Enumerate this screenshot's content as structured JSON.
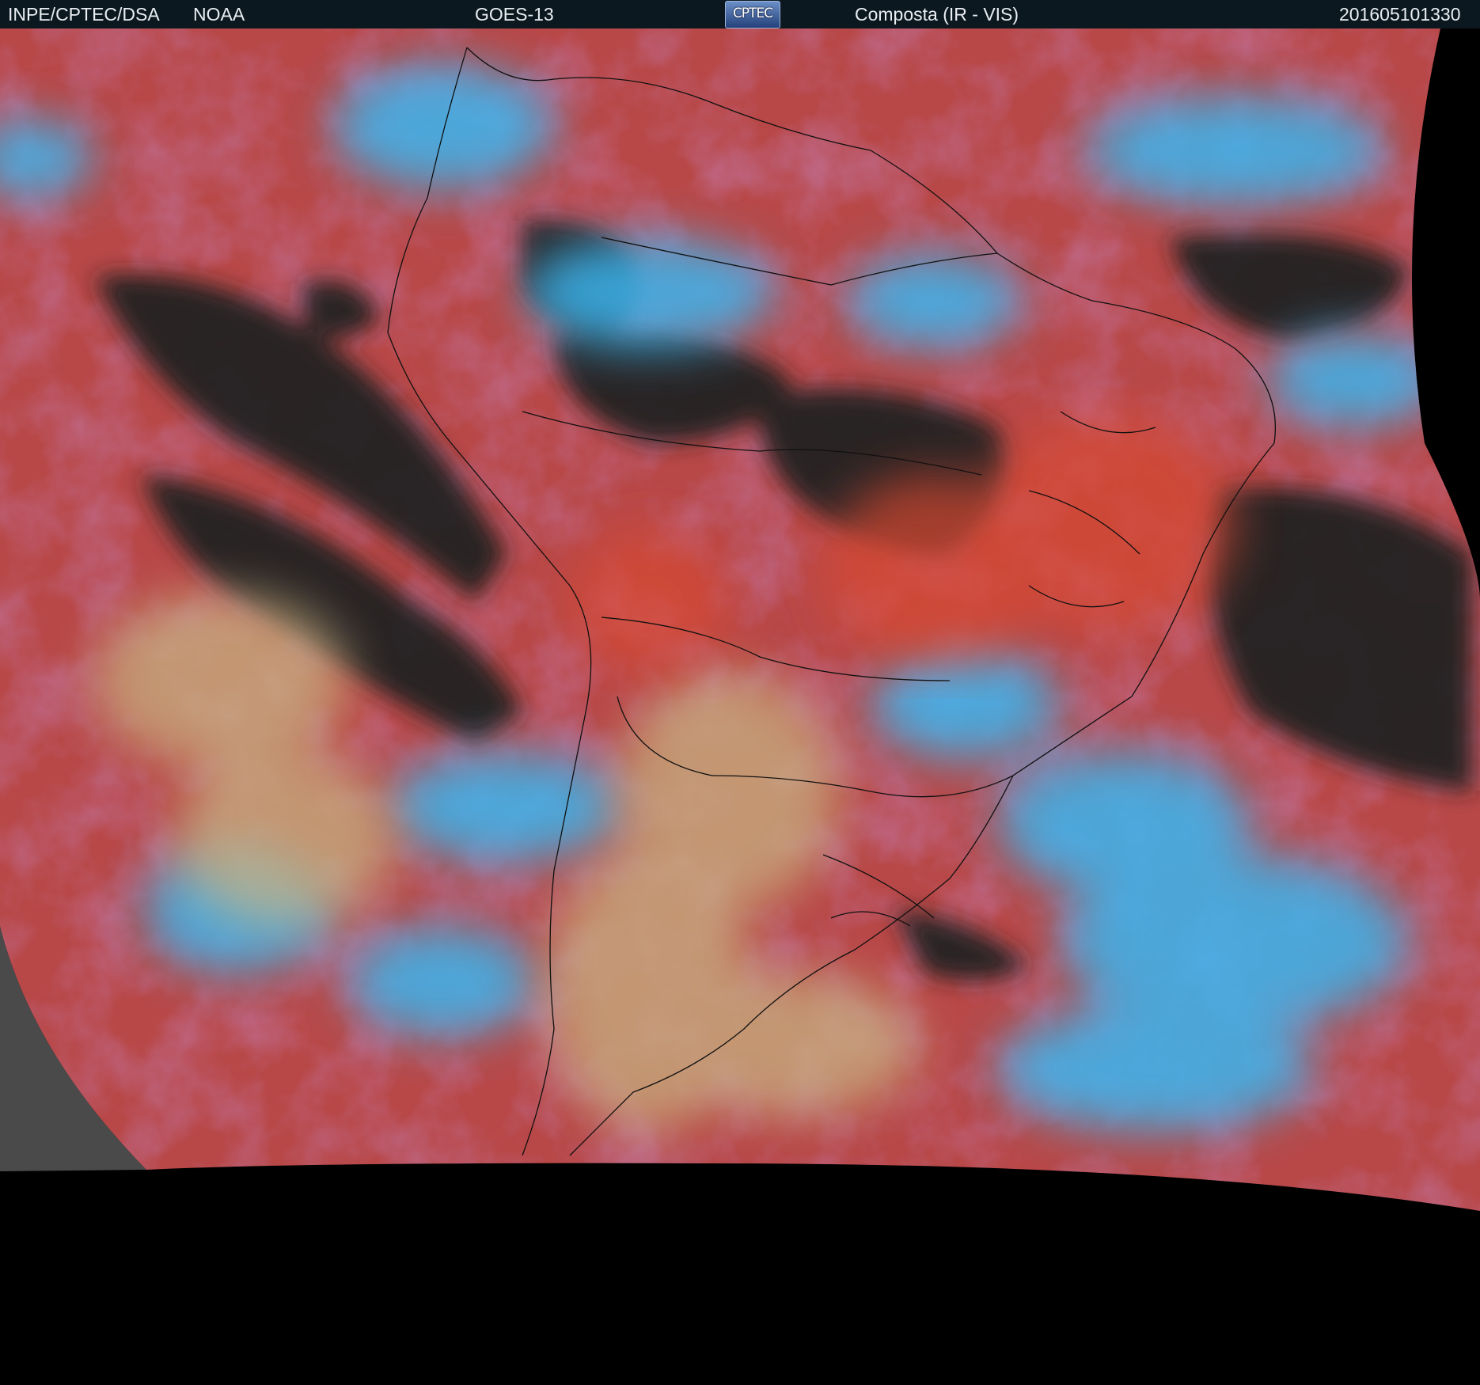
{
  "header": {
    "org": "INPE/CPTEC/DSA",
    "agency": "NOAA",
    "satellite": "GOES-13",
    "logo_text": "CPTEC",
    "product": "Composta (IR - VIS)",
    "timestamp": "201605101330"
  },
  "imagery": {
    "background_color": "#000000",
    "ocean_clear_color": "#b84848",
    "land_clear_color": "#c85440",
    "cold_cloud_color": "#3ab6f0",
    "mid_cloud_color": "#8a8fd0",
    "low_cloud_color": "#c8b080",
    "dark_region_color": "#232323",
    "border_line_color": "#101010"
  }
}
